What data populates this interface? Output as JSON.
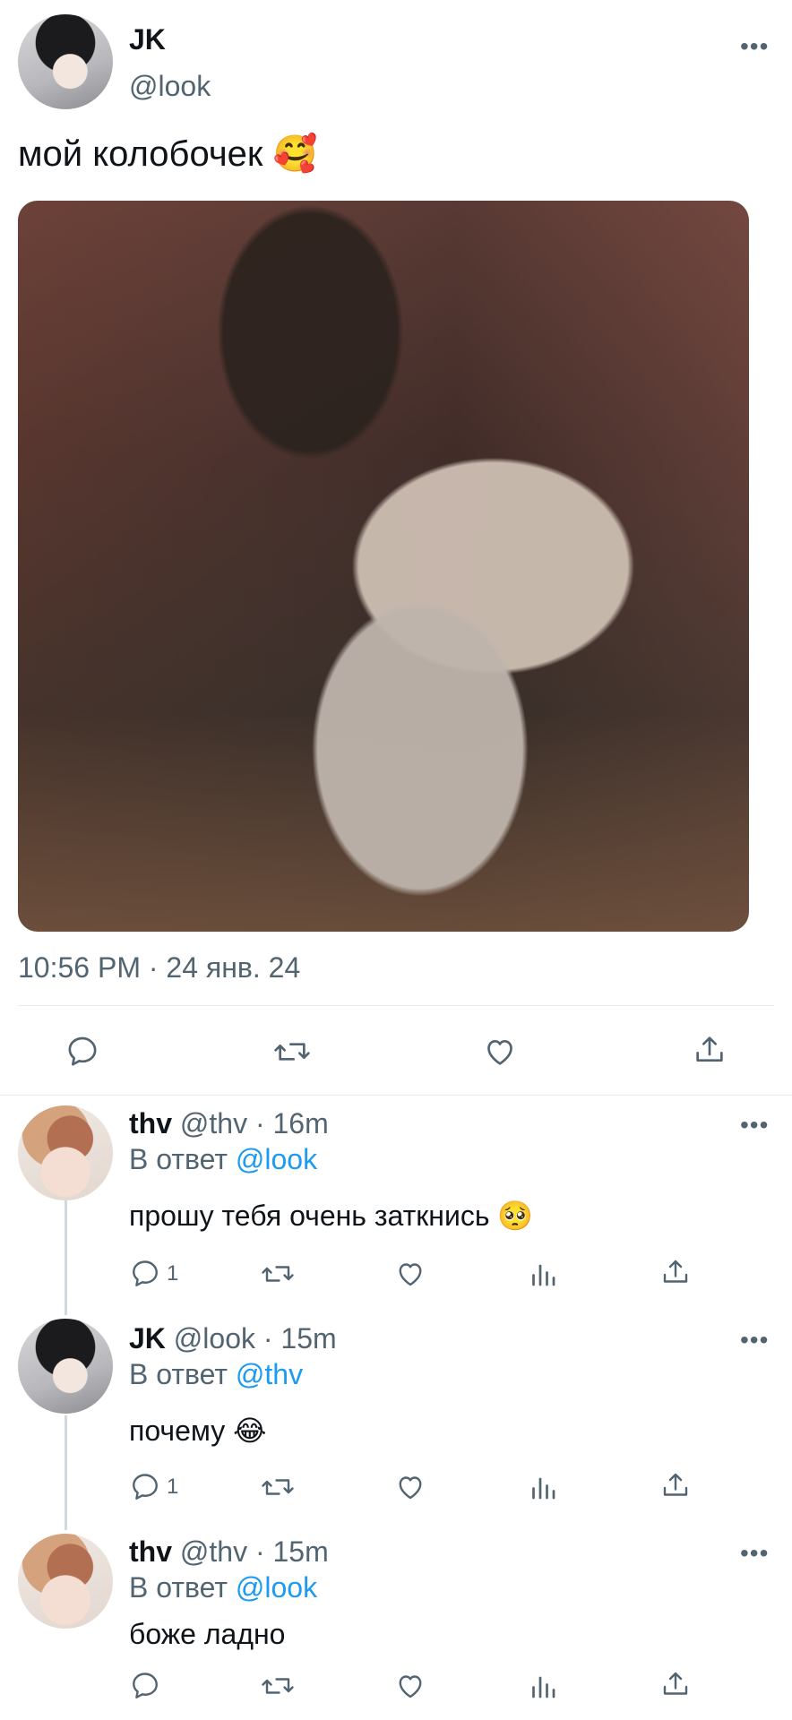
{
  "main_tweet": {
    "author_name": "JK",
    "author_handle": "@look",
    "text": "мой колобочек 🥰",
    "timestamp": "10:56 PM · 24 янв. 24",
    "more": "•••"
  },
  "replies": [
    {
      "author_name": "thv",
      "meta": "@thv · 16m",
      "reply_prefix": "В ответ",
      "reply_to": "@look",
      "text": "прошу тебя очень заткнись 🥺",
      "reply_count": "1",
      "more": "•••"
    },
    {
      "author_name": "JK",
      "meta": "@look · 15m",
      "reply_prefix": "В ответ",
      "reply_to": "@thv",
      "text": "почему 😂",
      "reply_count": "1",
      "more": "•••"
    },
    {
      "author_name": "thv",
      "meta": "@thv · 15m",
      "reply_prefix": "В ответ",
      "reply_to": "@look",
      "text": "боже ладно",
      "reply_count": "",
      "more": "•••"
    }
  ],
  "icons": {
    "reply": "reply-icon",
    "retweet": "retweet-icon",
    "like": "like-icon",
    "share": "share-icon",
    "views": "views-icon"
  },
  "colors": {
    "text": "#0f1419",
    "muted": "#536471",
    "link": "#1d9bf0",
    "divider": "#e6ecf0"
  }
}
